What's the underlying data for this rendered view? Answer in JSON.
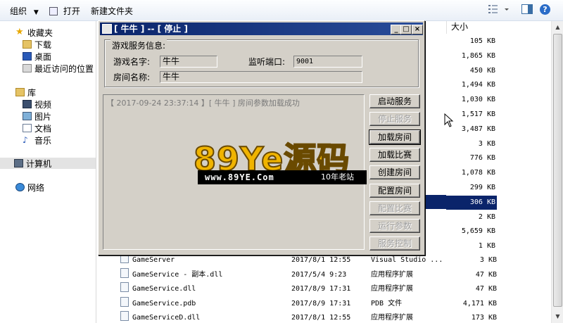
{
  "toolbar": {
    "organize_label": "组织",
    "organize_arrow": "▼",
    "open_label": "打开",
    "new_folder_label": "新建文件夹",
    "help_glyph": "?"
  },
  "nav": {
    "favorites_label": "收藏夹",
    "downloads_label": "下载",
    "desktop_label": "桌面",
    "recent_label": "最近访问的位置",
    "libraries_label": "库",
    "videos_label": "视频",
    "pictures_label": "图片",
    "documents_label": "文档",
    "music_label": "音乐",
    "computer_label": "计算机",
    "network_label": "网络"
  },
  "filelist": {
    "size_header": "大小",
    "sizes": [
      "105 KB",
      "1,865 KB",
      "450 KB",
      "1,494 KB",
      "1,030 KB",
      "1,517 KB",
      "3,487 KB",
      "3 KB",
      "776 KB",
      "1,078 KB",
      "299 KB",
      "306 KB",
      "2 KB",
      "5,659 KB",
      "1 KB"
    ],
    "partial_types": [
      "a ...",
      "a ..."
    ],
    "rows": [
      {
        "name": "GameServer",
        "date": "2017/8/1 12:55",
        "type": "Visual Studio ...",
        "size": "3 KB"
      },
      {
        "name": "GameService - 副本.dll",
        "date": "2017/5/4 9:23",
        "type": "应用程序扩展",
        "size": "47 KB"
      },
      {
        "name": "GameService.dll",
        "date": "2017/8/9 17:31",
        "type": "应用程序扩展",
        "size": "47 KB"
      },
      {
        "name": "GameService.pdb",
        "date": "2017/8/9 17:31",
        "type": "PDB 文件",
        "size": "4,171 KB"
      },
      {
        "name": "GameServiceD.dll",
        "date": "2017/8/1 12:55",
        "type": "应用程序扩展",
        "size": "173 KB"
      }
    ]
  },
  "dialog": {
    "title": "[ 牛牛 ] -- [ 停止 ]",
    "min_glyph": "_",
    "max_glyph": "□",
    "close_glyph": "×",
    "group_title": "游戏服务信息:",
    "game_name_label": "游戏名字:",
    "game_name_value": "牛牛",
    "port_label": "监听端口:",
    "port_value": "9001",
    "room_name_label": "房间名称:",
    "room_name_value": "牛牛",
    "log_line": "【 2017-09-24 23:37:14 】[ 牛牛 ] 房间参数加载成功",
    "buttons": [
      {
        "label": "启动服务",
        "enabled": true
      },
      {
        "label": "停止服务",
        "enabled": false
      },
      {
        "label": "加载房间",
        "enabled": true
      },
      {
        "label": "加载比赛",
        "enabled": true
      },
      {
        "label": "创建房间",
        "enabled": true
      },
      {
        "label": "配置房间",
        "enabled": true
      },
      {
        "label": "配置比赛",
        "enabled": false
      },
      {
        "label": "运行参数",
        "enabled": false
      },
      {
        "label": "服务控制",
        "enabled": false
      }
    ]
  },
  "watermark": {
    "brand": "89Ye源码",
    "url": "www.89YE.Com",
    "tagline": "10年老站"
  },
  "colors": {
    "titlebar": "#0a246a",
    "dialog_face": "#d4d0c8",
    "selection": "#0a246a",
    "watermark_gold": "#f0b400"
  }
}
